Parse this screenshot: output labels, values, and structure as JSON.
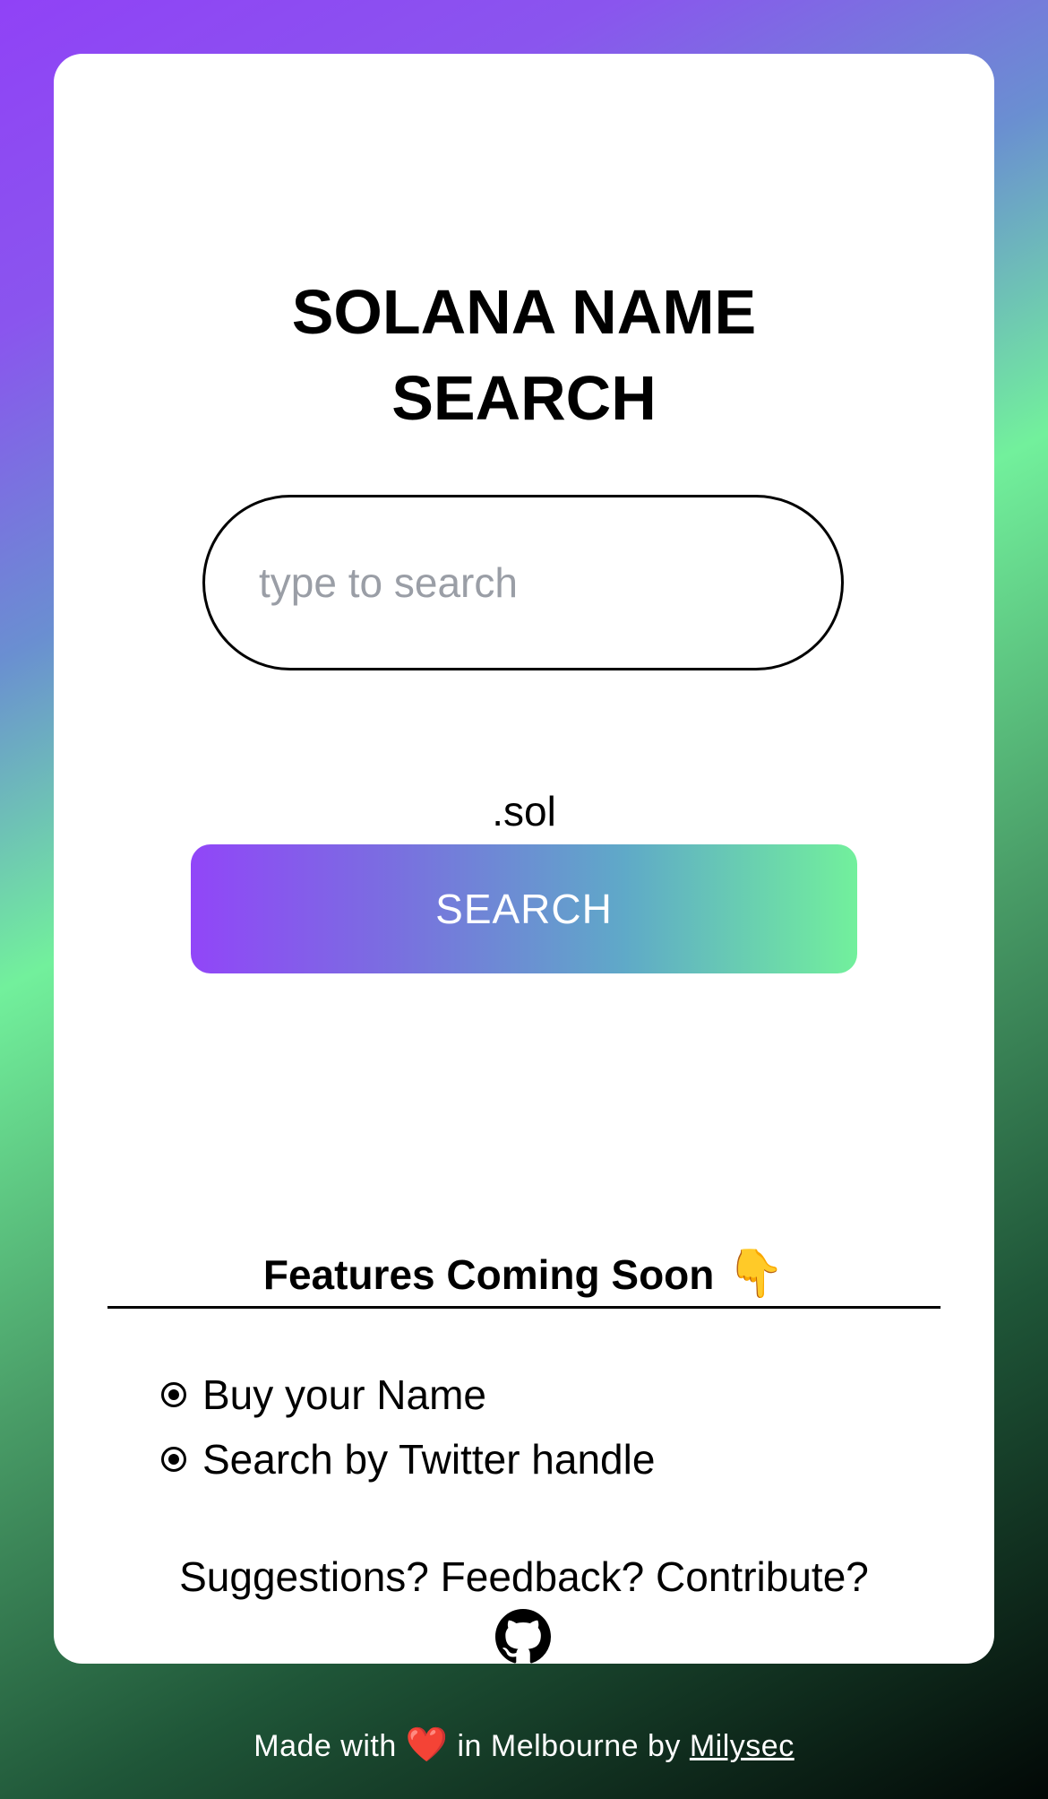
{
  "header": {
    "title_line1": "SOLANA NAME",
    "title_line2": "SEARCH"
  },
  "search": {
    "placeholder": "type to search",
    "value": "",
    "suffix": ".sol",
    "button_label": "SEARCH"
  },
  "features": {
    "heading": "Features Coming Soon",
    "heading_emoji": "👇",
    "items": [
      {
        "label": "Buy your Name",
        "icon": "radio-dot-icon"
      },
      {
        "label": "Search by Twitter handle",
        "icon": "radio-dot-icon"
      }
    ]
  },
  "contribute": {
    "text": "Suggestions? Feedback? Contribute?",
    "icon": "github-icon"
  },
  "footer": {
    "prefix": "Made with",
    "heart": "❤️",
    "middle": "in Melbourne by",
    "author_link": "Milysec"
  },
  "colors": {
    "gradient_purple": "#9146f8",
    "gradient_green": "#72f09c",
    "card_background": "#ffffff",
    "text": "#000000"
  }
}
